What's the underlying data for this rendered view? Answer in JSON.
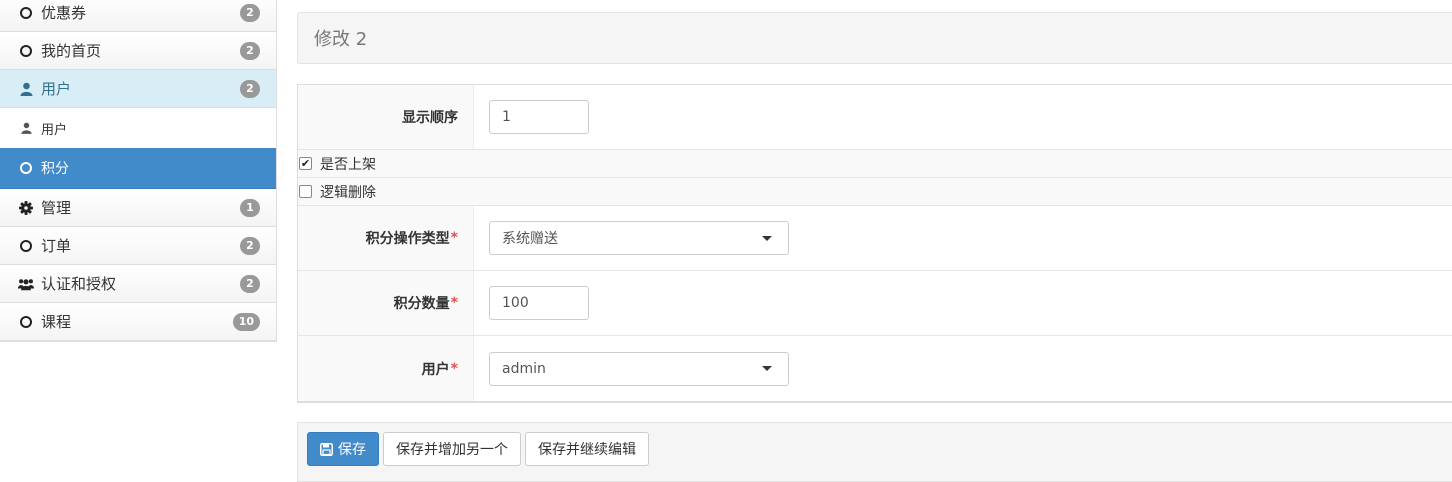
{
  "sidebar": {
    "items": [
      {
        "label": "优惠券",
        "badge": "2"
      },
      {
        "label": "我的首页",
        "badge": "2"
      },
      {
        "label": "用户",
        "badge": "2"
      },
      {
        "label": "用户"
      },
      {
        "label": "积分"
      },
      {
        "label": "管理",
        "badge": "1"
      },
      {
        "label": "订单",
        "badge": "2"
      },
      {
        "label": "认证和授权",
        "badge": "2"
      },
      {
        "label": "课程",
        "badge": "10"
      }
    ]
  },
  "header": {
    "title": "修改 2"
  },
  "form": {
    "display_order": {
      "label": "显示顺序",
      "value": "1"
    },
    "is_listed": {
      "label": "是否上架",
      "checked": true
    },
    "logical_delete": {
      "label": "逻辑删除",
      "checked": false
    },
    "points_op_type": {
      "label": "积分操作类型",
      "required": "*",
      "value": "系统赠送"
    },
    "points_amount": {
      "label": "积分数量",
      "required": "*",
      "value": "100"
    },
    "user": {
      "label": "用户",
      "required": "*",
      "value": "admin"
    }
  },
  "actions": {
    "save": "保存",
    "save_add_another": "保存并增加另一个",
    "save_continue": "保存并继续编辑"
  },
  "colors": {
    "primary": "#428bca",
    "open_bg": "#d9edf7",
    "required": "#d9534f",
    "badge": "#999999"
  }
}
